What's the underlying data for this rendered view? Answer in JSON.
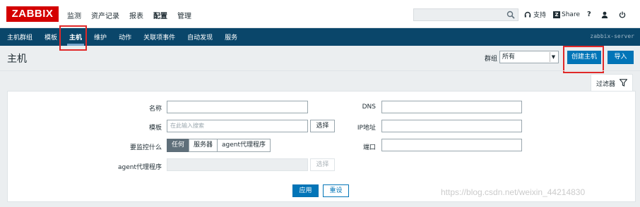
{
  "topbar": {
    "logo": "ZABBIX",
    "menu": [
      "监测",
      "资产记录",
      "报表",
      "配置",
      "管理"
    ],
    "active_menu": "配置",
    "search_value": "",
    "support_label": "支持",
    "share_label": "Share",
    "help_label": "?"
  },
  "subnav": {
    "items": [
      "主机群组",
      "模板",
      "主机",
      "维护",
      "动作",
      "关联项事件",
      "自动发现",
      "服务"
    ],
    "active": "主机",
    "server_name": "zabbix-server"
  },
  "header": {
    "title": "主机",
    "group_label": "群组",
    "group_value": "所有",
    "create_button": "创建主机",
    "import_button": "导入"
  },
  "filter": {
    "tab_label": "过滤器",
    "name_label": "名称",
    "name_value": "",
    "template_label": "模板",
    "template_placeholder": "在此输入搜索",
    "select_button": "选择",
    "monitored_by_label": "要监控什么",
    "monitored_by_options": [
      "任何",
      "服务器",
      "agent代理程序"
    ],
    "monitored_by_selected": "任何",
    "proxy_label": "agent代理程序",
    "proxy_value": "",
    "proxy_select_button": "选择",
    "dns_label": "DNS",
    "dns_value": "",
    "ip_label": "IP地址",
    "ip_value": "",
    "port_label": "端口",
    "port_value": "",
    "apply_button": "应用",
    "reset_button": "重设"
  },
  "watermark": "https://blog.csdn.net/weixin_44214830",
  "colors": {
    "brand_red": "#d40000",
    "nav_blue": "#0a466a",
    "primary_button": "#0275b8",
    "highlight_box": "#e02828"
  }
}
